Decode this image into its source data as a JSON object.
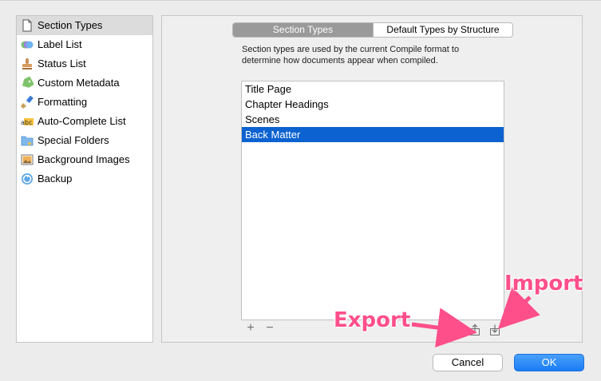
{
  "sidebar": {
    "items": [
      {
        "label": "Section Types",
        "icon": "document-icon",
        "selected": true
      },
      {
        "label": "Label List",
        "icon": "label-circles-icon"
      },
      {
        "label": "Status List",
        "icon": "stamp-icon"
      },
      {
        "label": "Custom Metadata",
        "icon": "tag-icon"
      },
      {
        "label": "Formatting",
        "icon": "brush-icon"
      },
      {
        "label": "Auto-Complete List",
        "icon": "abc-icon"
      },
      {
        "label": "Special Folders",
        "icon": "folder-icon"
      },
      {
        "label": "Background Images",
        "icon": "image-icon"
      },
      {
        "label": "Backup",
        "icon": "backup-icon"
      }
    ]
  },
  "main": {
    "tabs": [
      {
        "label": "Section Types",
        "selected": true
      },
      {
        "label": "Default Types by Structure",
        "selected": false
      }
    ],
    "description": "Section types are used by the current Compile format to determine how documents appear when compiled.",
    "list": [
      {
        "label": "Title Page"
      },
      {
        "label": "Chapter Headings"
      },
      {
        "label": "Scenes"
      },
      {
        "label": "Back Matter",
        "selected": true
      }
    ],
    "add_label": "+",
    "remove_label": "−"
  },
  "annotations": {
    "export": "Export",
    "import": "Import",
    "color": "#ff4f8b"
  },
  "footer": {
    "cancel_label": "Cancel",
    "ok_label": "OK"
  },
  "colors": {
    "selection": "#0b62d0",
    "accent": "#1a7cf5"
  }
}
